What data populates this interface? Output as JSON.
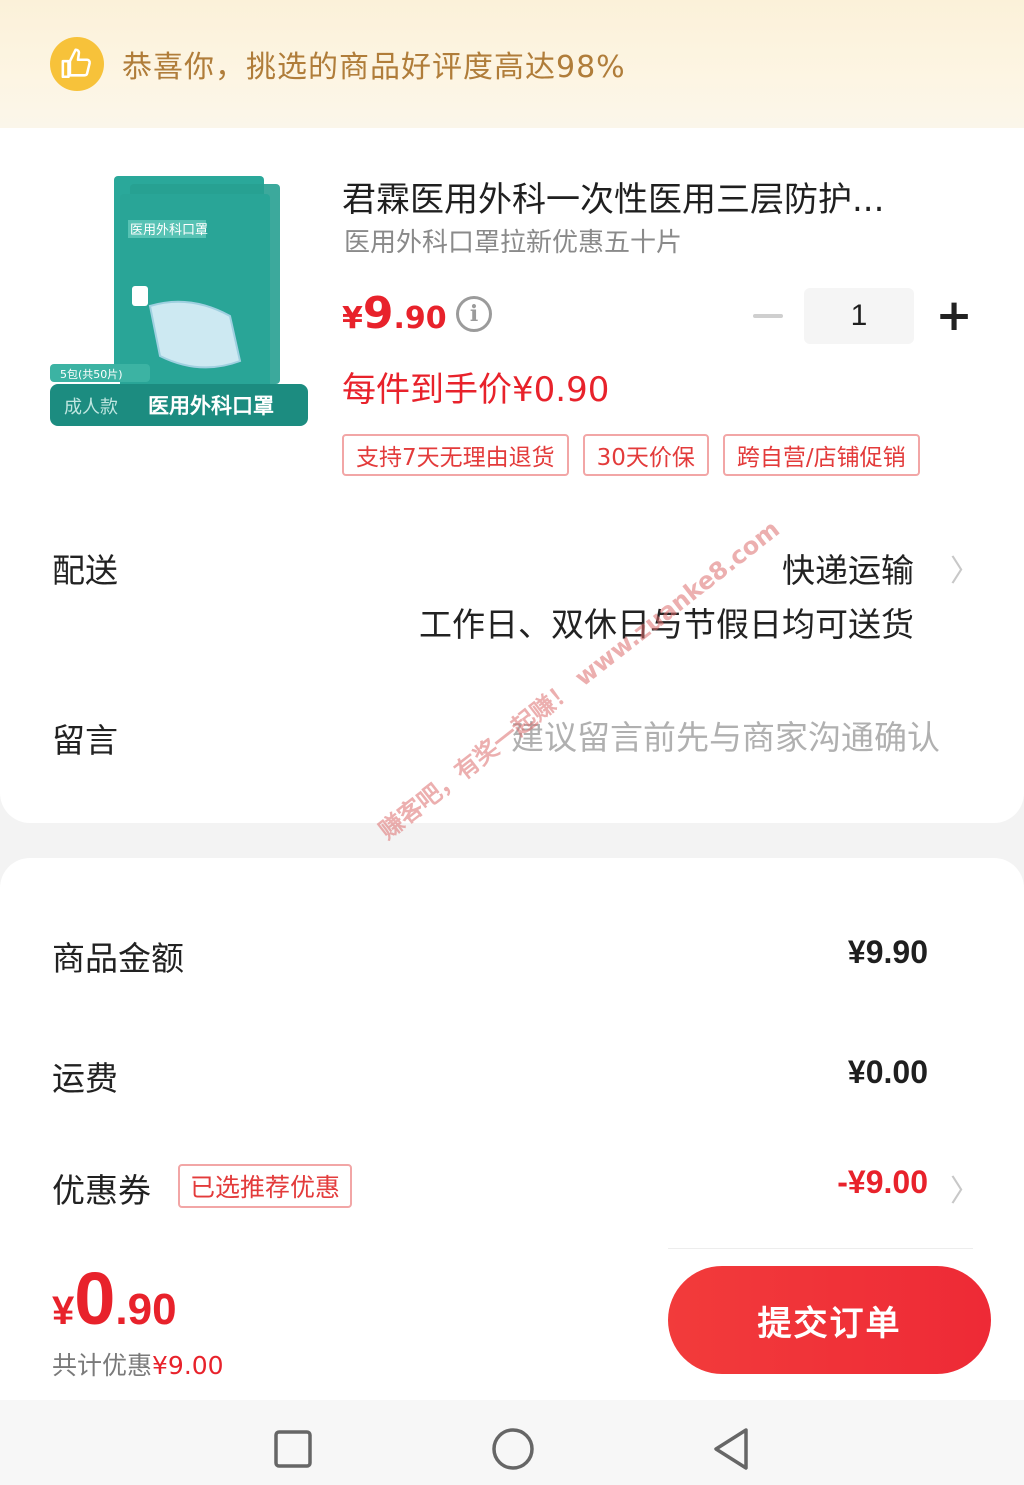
{
  "banner": {
    "text": "恭喜你，挑选的商品好评度高达98%",
    "icon": "thumbs-up-icon"
  },
  "product": {
    "title": "君霖医用外科一次性医用三层防护...",
    "subtitle": "医用外科口罩拉新优惠五十片",
    "price_symbol": "¥",
    "price_integer": "9",
    "price_decimal": ".90",
    "quantity": "1",
    "each_price": "每件到手价¥0.90",
    "tags": [
      "支持7天无理由退货",
      "30天价保",
      "跨自营/店铺促销"
    ],
    "image": {
      "pack_count_label": "5包(共50片)",
      "badge_label": "成人款",
      "product_label": "医用外科口罩",
      "pack_title": "医用外科口罩"
    }
  },
  "delivery": {
    "label": "配送",
    "method": "快递运输",
    "description": "工作日、双休日与节假日均可送货"
  },
  "message": {
    "label": "留言",
    "placeholder": "建议留言前先与商家沟通确认"
  },
  "watermark": "赚客吧，有奖一起赚！ www.zuanke8.com",
  "summary": {
    "goods_amount_label": "商品金额",
    "goods_amount": "¥9.90",
    "shipping_label": "运费",
    "shipping_amount": "¥0.00",
    "coupon_label": "优惠券",
    "coupon_badge": "已选推荐优惠",
    "coupon_amount": "-¥9.00"
  },
  "footer": {
    "total_symbol": "¥",
    "total_integer": "0",
    "total_decimal": ".90",
    "discount_label": "共计优惠",
    "discount_amount": "¥9.00",
    "submit_label": "提交订单"
  },
  "colors": {
    "accent": "#e8222b",
    "banner_text": "#b07d3a",
    "badge": "#f7c23a"
  }
}
